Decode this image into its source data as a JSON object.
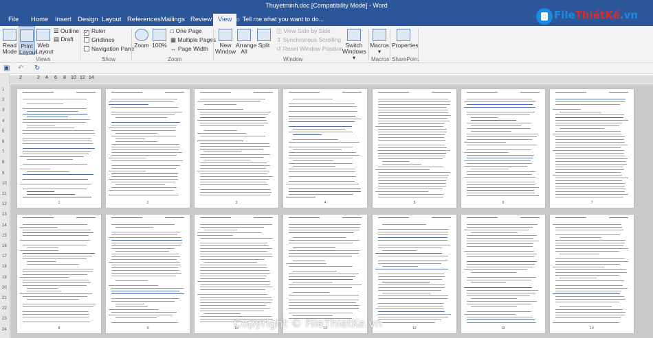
{
  "window": {
    "title": "Thuyetminh.doc [Compatibility Mode] - Word"
  },
  "tabs": [
    "File",
    "Home",
    "Insert",
    "Design",
    "Layout",
    "References",
    "Mailings",
    "Review",
    "View"
  ],
  "tell_me": "Tell me what you want to do...",
  "logo": {
    "prefix": "File",
    "name": "ThiếtKế",
    "suffix": ".vn"
  },
  "ribbon": {
    "views": {
      "read_mode": "Read Mode",
      "print_layout": "Print Layout",
      "web_layout": "Web Layout",
      "outline": "Outline",
      "draft": "Draft",
      "group": "Views"
    },
    "show": {
      "ruler": "Ruler",
      "gridlines": "Gridlines",
      "nav_pane": "Navigation Pane",
      "group": "Show"
    },
    "zoom": {
      "zoom": "Zoom",
      "zoom100": "100%",
      "one_page": "One Page",
      "multiple_pages": "Multiple Pages",
      "page_width": "Page Width",
      "group": "Zoom"
    },
    "window": {
      "new_window": "New Window",
      "arrange_all": "Arrange All",
      "split": "Split",
      "side_by_side": "View Side by Side",
      "sync_scroll": "Synchronous Scrolling",
      "reset_pos": "Reset Window Position",
      "switch_windows": "Switch Windows",
      "group": "Window"
    },
    "macros": {
      "label": "Macros",
      "group": "Macros"
    },
    "sharepoint": {
      "label": "Properties",
      "group": "SharePoint"
    }
  },
  "ruler": {
    "numbers": [
      "2",
      "2",
      "4",
      "6",
      "8",
      "10",
      "12",
      "14"
    ]
  },
  "vruler": {
    "numbers": [
      "1",
      "2",
      "3",
      "4",
      "5",
      "6",
      "7",
      "8",
      "9",
      "10",
      "11",
      "12",
      "13",
      "14",
      "15",
      "16",
      "17",
      "18",
      "19",
      "20",
      "21",
      "22",
      "23",
      "24"
    ]
  },
  "pages_row1": [
    "1",
    "2",
    "3",
    "4",
    "5",
    "6",
    "7"
  ],
  "pages_row2": [
    "8",
    "9",
    "10",
    "11",
    "12",
    "13",
    "14"
  ],
  "watermark": "Copyright © FileThietKe.vn",
  "colors": {
    "accent": "#2b579a",
    "ribbon_bg": "#f3f3f3",
    "workspace": "#c9c9c9"
  }
}
